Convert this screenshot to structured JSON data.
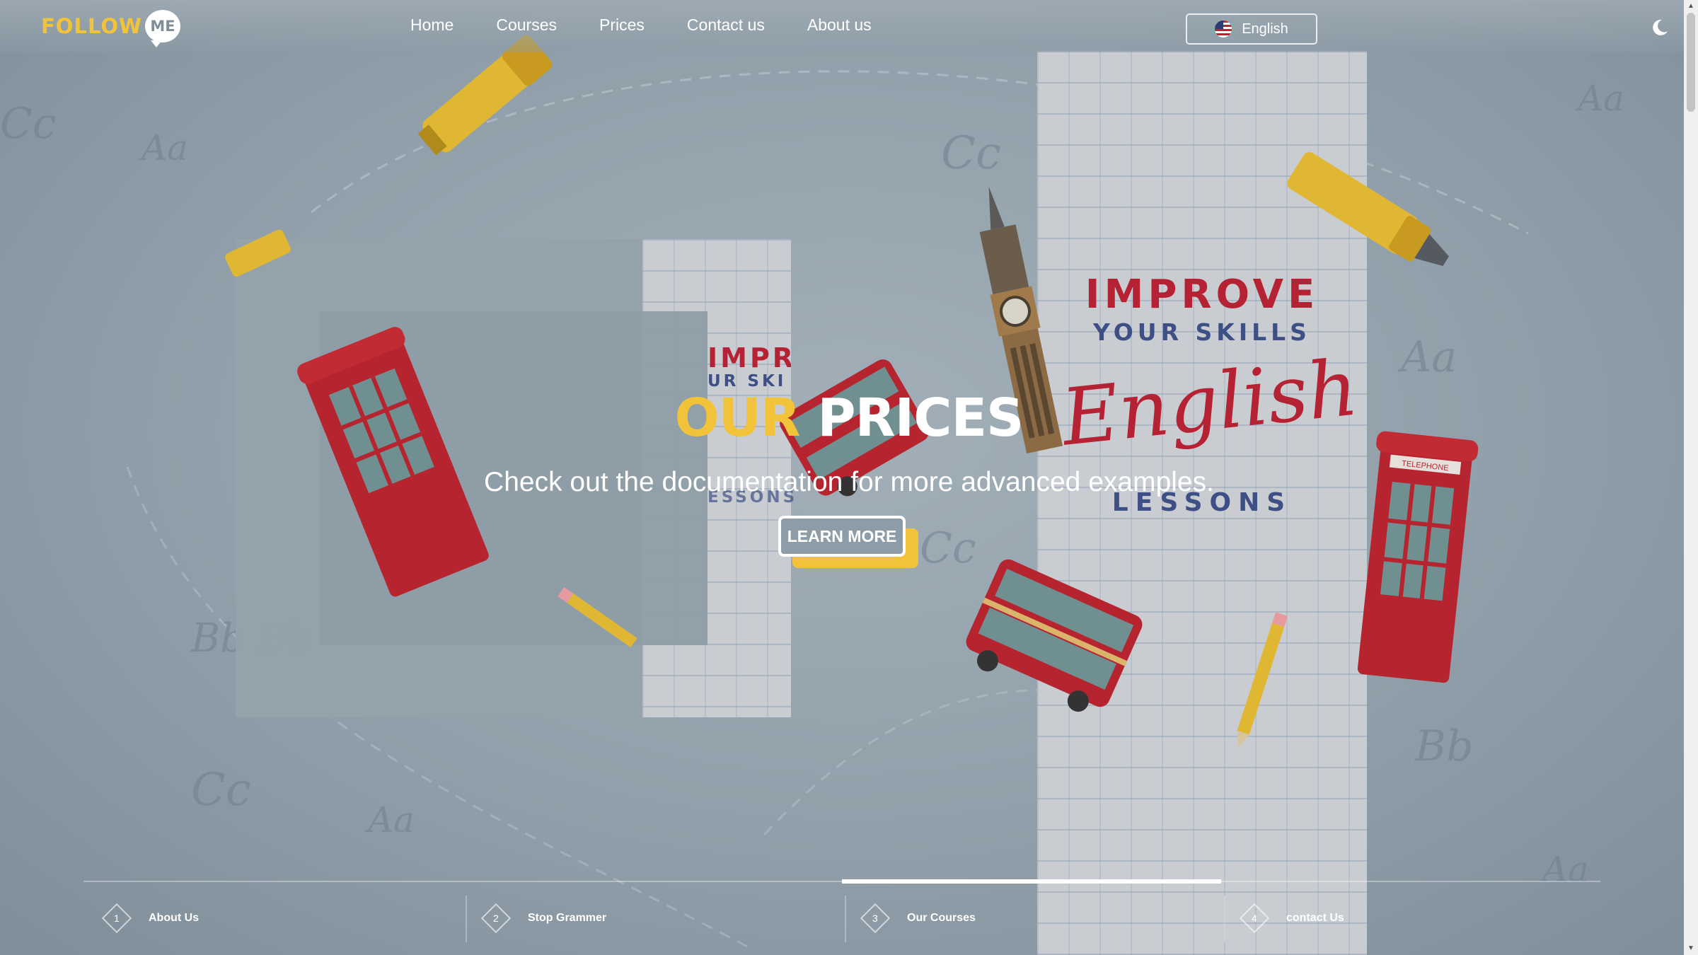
{
  "brand": {
    "logo_main": "FOLLOW",
    "logo_bubble": "ME",
    "accent": "#f2c338"
  },
  "nav": {
    "items": [
      {
        "label": "Home"
      },
      {
        "label": "Courses"
      },
      {
        "label": "Prices"
      },
      {
        "label": "Contact us"
      },
      {
        "label": "About us"
      }
    ]
  },
  "language": {
    "label": "English",
    "flag_icon": "us-flag-icon"
  },
  "theme_toggle": {
    "icon": "moon-icon"
  },
  "hero": {
    "title_part1": "OUR",
    "title_part2": "PRICES",
    "subtitle": "Check out the documentation for more advanced examples.",
    "button_label": "LEARN MORE"
  },
  "background_art": {
    "improve": "IMPROVE",
    "your_skills": "YOUR SKILLS",
    "english": "English",
    "lessons": "LESSONS",
    "telephone": "TELEPHONE",
    "small_improve": "IMPRO",
    "small_skills": "UR SKI",
    "small_lessons": "ESSONS"
  },
  "slider_tabs": [
    {
      "number": "1",
      "label": "About Us"
    },
    {
      "number": "2",
      "label": "Stop Grammer"
    },
    {
      "number": "3",
      "label": "Our Courses",
      "active": true
    },
    {
      "number": "4",
      "label": "contact Us"
    }
  ]
}
